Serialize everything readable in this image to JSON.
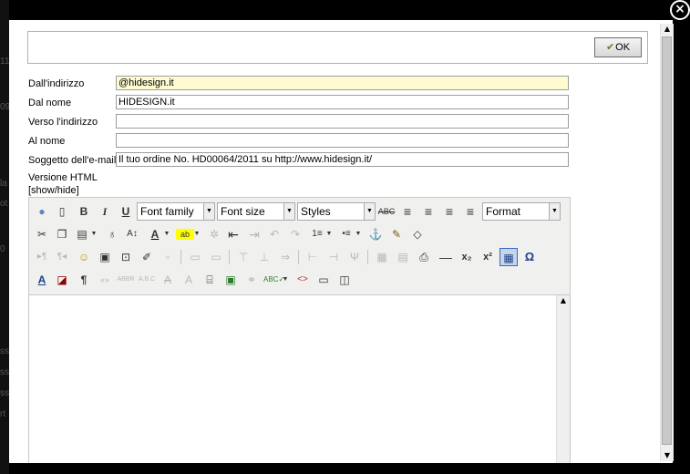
{
  "dialog": {
    "close_symbol": "×",
    "ok_label": "OK"
  },
  "background_snippets": [
    "11",
    "09",
    "la",
    "ot",
    "0",
    "ss",
    "ss",
    "ss",
    "rt"
  ],
  "form": {
    "from_address_label": "Dall'indirizzo",
    "from_address_value": "@hidesign.it",
    "from_name_label": "Dal nome",
    "from_name_value": "HIDESIGN.it",
    "to_address_label": "Verso l'indirizzo",
    "to_address_value": "",
    "to_name_label": "Al nome",
    "to_name_value": "",
    "subject_label": "Soggetto dell'e-mail",
    "subject_value": "Il tuo ordine No. HD00064/2011  su http://www.hidesign.it/",
    "html_version_label": "Versione HTML",
    "show_hide_label": "[show/hide]"
  },
  "editor": {
    "font_family": "Font family",
    "font_size": "Font size",
    "styles": "Styles",
    "format": "Format"
  }
}
